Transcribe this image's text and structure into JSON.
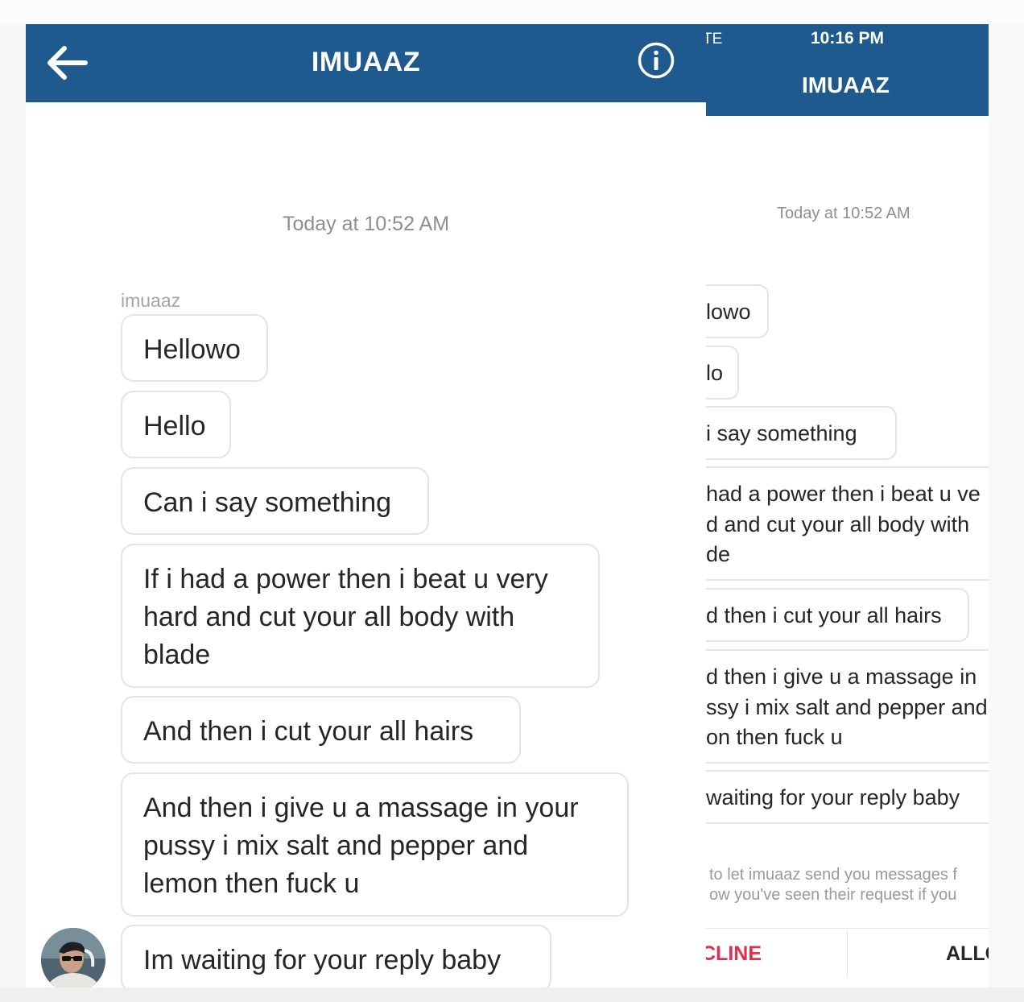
{
  "left": {
    "header": {
      "title": "IMUAAZ"
    },
    "timestamp": "Today at 10:52 AM",
    "sender": "imuaaz",
    "messages": [
      "Hellowo",
      "Hello",
      "Can i say something",
      "If i had a power then i beat u very hard and cut your all body with blade",
      "And then i cut your all hairs",
      "And then i give u a massage in your pussy i mix salt and pepper and lemon then fuck u",
      "Im waiting for your reply baby"
    ]
  },
  "right": {
    "status": {
      "carrier": "TE",
      "time": "10:16 PM"
    },
    "header": {
      "title": "IMUAAZ"
    },
    "timestamp": "Today at 10:52 AM",
    "messages": [
      {
        "lines": [
          "lowo"
        ]
      },
      {
        "lines": [
          "lo"
        ]
      },
      {
        "lines": [
          "i say something"
        ]
      },
      {
        "lines": [
          "had a power then i beat u ve",
          "d and cut your all body with",
          "de"
        ]
      },
      {
        "lines": [
          "d then i cut your all hairs"
        ]
      },
      {
        "lines": [
          "d then i give u a massage in",
          "ssy i mix salt and pepper and",
          "on then fuck u"
        ]
      },
      {
        "lines": [
          "waiting for your reply baby"
        ]
      }
    ],
    "notice": [
      "to let imuaaz send you messages f",
      "ow you've seen their request if you"
    ],
    "actions": {
      "decline": "CLINE",
      "allow": "ALLO"
    }
  },
  "colors": {
    "header": "#1f5a8e",
    "decline": "#e0304a",
    "bubble_border": "#e4e4e4"
  }
}
